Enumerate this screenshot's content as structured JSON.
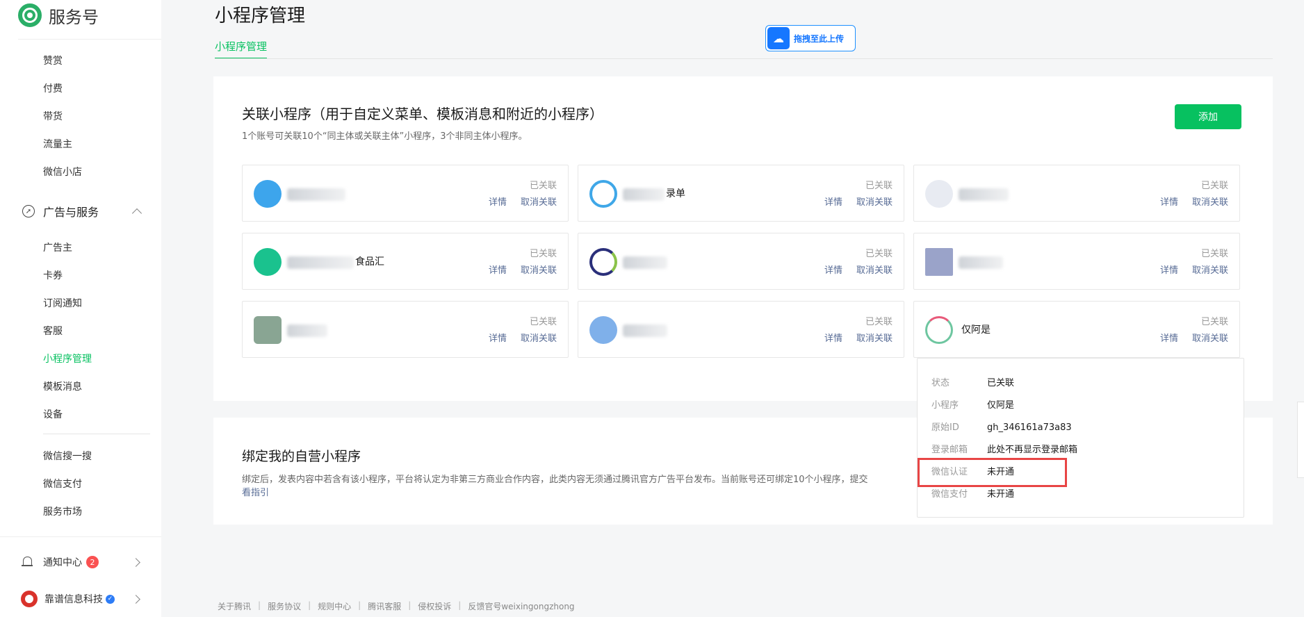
{
  "app": {
    "name": "服务号"
  },
  "sidebar": {
    "items_top": [
      "赞赏",
      "付费",
      "带货",
      "流量主",
      "微信小店"
    ],
    "group": {
      "label": "广告与服务"
    },
    "items_group": [
      "广告主",
      "卡券",
      "订阅通知",
      "客服",
      "小程序管理",
      "模板消息",
      "设备"
    ],
    "items_more": [
      "微信搜一搜",
      "微信支付",
      "服务市场"
    ],
    "notify": {
      "label": "通知中心",
      "count": "2"
    },
    "account": {
      "name": "靠谱信息科技"
    }
  },
  "header": {
    "title": "小程序管理",
    "tab": "小程序管理"
  },
  "upload": {
    "label": "拖拽至此上传"
  },
  "related": {
    "title": "关联小程序（用于自定义菜单、模板消息和附近的小程序）",
    "desc": "1个账号可关联10个“同主体或关联主体”小程序，3个非同主体小程序。",
    "add_label": "添加",
    "status_label": "已关联",
    "detail_label": "详情",
    "unlink_label": "取消关联",
    "visible_name": "仅阿是",
    "partial_texts": [
      "录单",
      "食品汇"
    ]
  },
  "detail_popup": {
    "rows": [
      {
        "k": "状态",
        "v": "已关联"
      },
      {
        "k": "小程序",
        "v": "仅阿是"
      },
      {
        "k": "原始ID",
        "v": "gh_346161a73a83"
      },
      {
        "k": "登录邮箱",
        "v": "此处不再显示登录邮箱"
      },
      {
        "k": "微信认证",
        "v": "未开通"
      },
      {
        "k": "微信支付",
        "v": "未开通"
      }
    ]
  },
  "bound": {
    "title": "绑定我的自营小程序",
    "desc": "绑定后，发表内容中若含有该小程序，平台将认定为非第三方商业合作内容，此类内容无须通过腾讯官方广告平台发布。当前账号还可绑定10个小程序，提交",
    "guide_link": "看指引"
  },
  "footer": {
    "links": [
      "关于腾讯",
      "服务协议",
      "规则中心",
      "腾讯客服",
      "侵权投诉",
      "反馈官号weixingongzhong"
    ]
  },
  "colors": {
    "accent": "#07c160",
    "link": "#576b95",
    "alert": "#e84545",
    "badge": "#fa5151"
  }
}
